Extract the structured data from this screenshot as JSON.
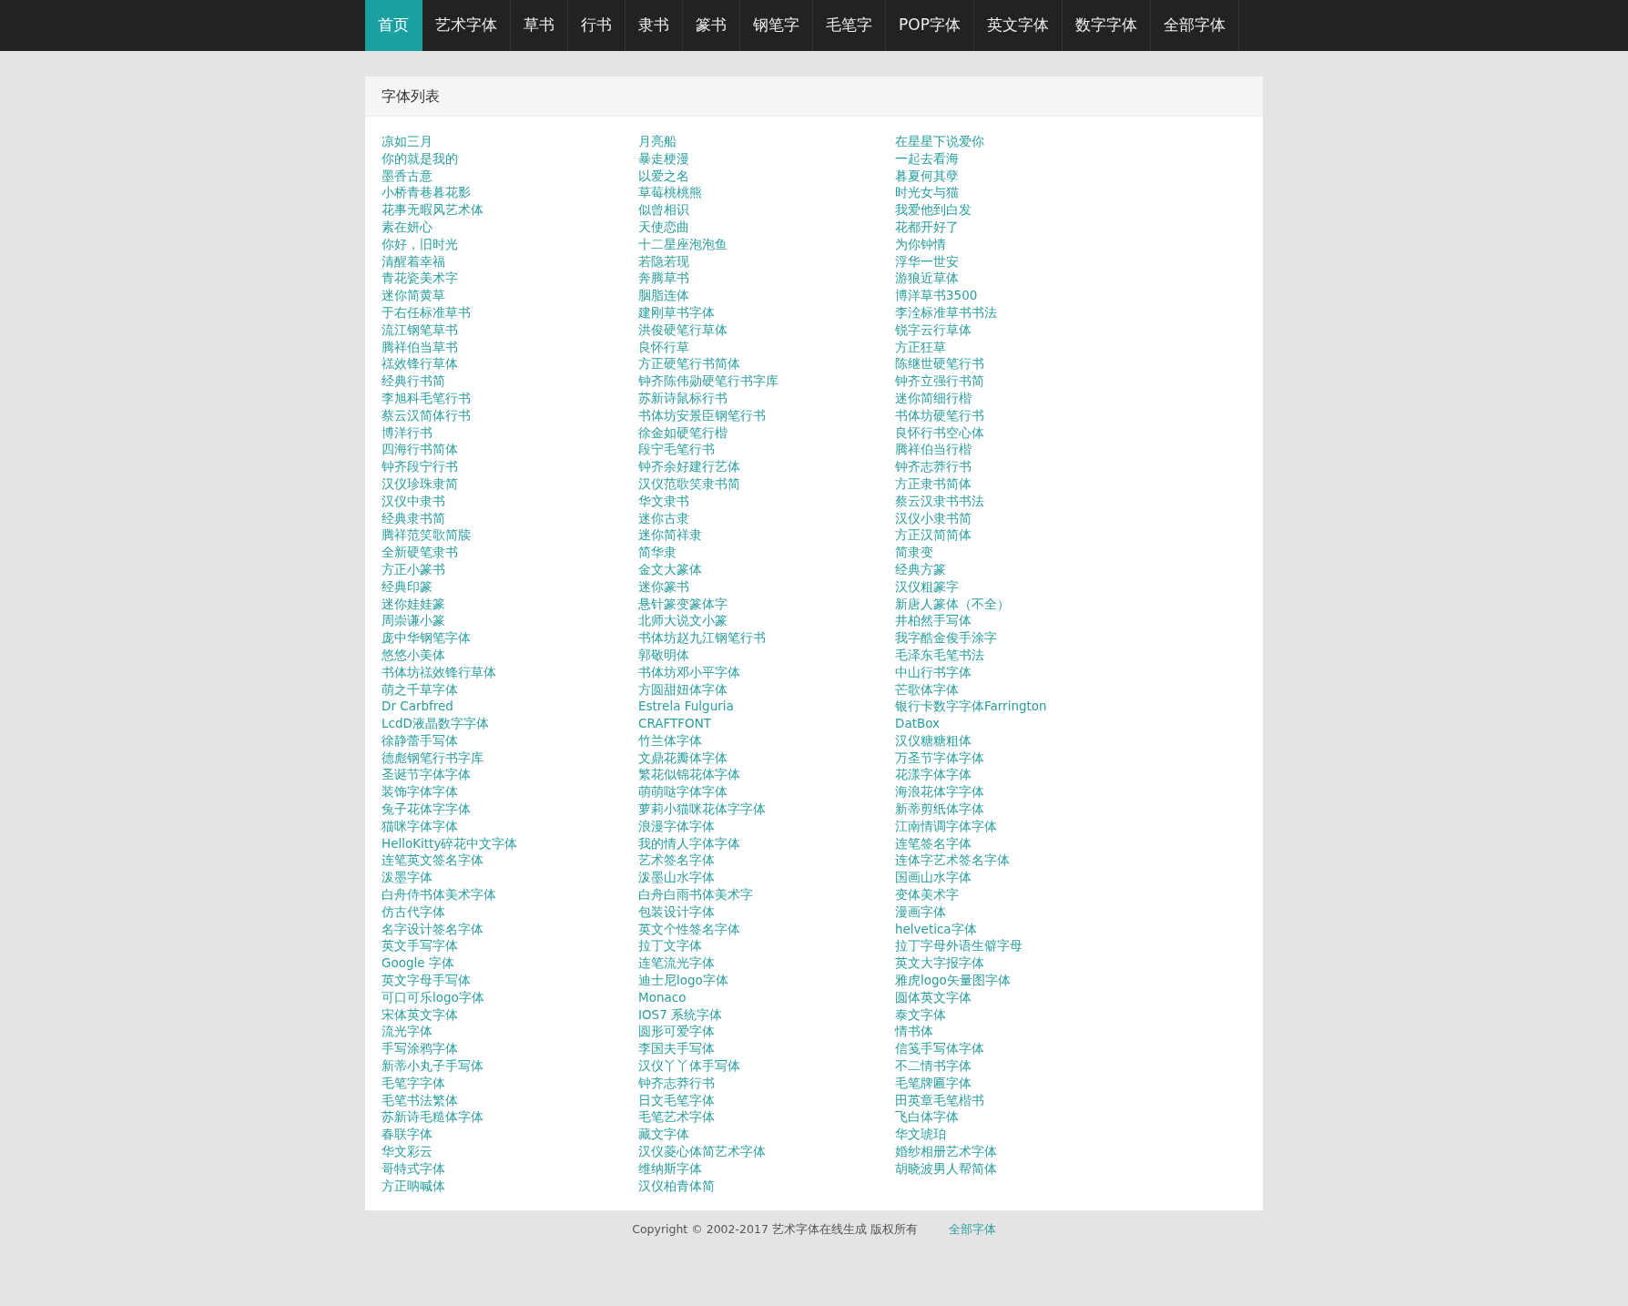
{
  "navbar": {
    "items": [
      {
        "label": "首页",
        "selected": true
      },
      {
        "label": "艺术字体",
        "selected": false
      },
      {
        "label": "草书",
        "selected": false
      },
      {
        "label": "行书",
        "selected": false
      },
      {
        "label": "隶书",
        "selected": false
      },
      {
        "label": "篆书",
        "selected": false
      },
      {
        "label": "钢笔字",
        "selected": false
      },
      {
        "label": "毛笔字",
        "selected": false
      },
      {
        "label": "POP字体",
        "selected": false
      },
      {
        "label": "英文字体",
        "selected": false
      },
      {
        "label": "数字字体",
        "selected": false
      },
      {
        "label": "全部字体",
        "selected": false
      }
    ]
  },
  "panel": {
    "title": "字体列表",
    "columns": [
      {
        "items": [
          "凉如三月",
          "你的就是我的",
          "墨香古意",
          "小桥青巷暮花影",
          "花事无暇风艺术体",
          "素在妍心",
          "你好，旧时光",
          "清醒着幸福",
          "青花瓷美术字",
          "迷你简黄草",
          "于右任标准草书",
          "流江钢笔草书",
          "腾祥伯当草书",
          "禚效锋行草体",
          "经典行书简",
          "李旭科毛笔行书",
          "蔡云汉简体行书",
          "博洋行书",
          "四海行书简体",
          "钟齐段宁行书",
          "汉仪珍珠隶简",
          "汉仪中隶书",
          "经典隶书简",
          "腾祥范笑歌简牍",
          "全新硬笔隶书",
          "方正小篆书",
          "经典印篆",
          "迷你娃娃篆",
          "周崇谦小篆",
          "庞中华钢笔字体",
          "悠悠小美体",
          "书体坊禚效锋行草体",
          "萌之千草字体",
          "Dr Carbfred",
          "LcdD液晶数字字体",
          "徐静蕾手写体",
          "德彪钢笔行书字库",
          "圣诞节字体字体",
          "装饰字体字体",
          "兔子花体字字体",
          "猫咪字体字体",
          "HelloKitty碎花中文字体",
          "连笔英文签名字体",
          "泼墨字体",
          "白舟侍书体美术字体",
          "仿古代字体",
          "名字设计签名字体",
          "英文手写字体",
          "Google 字体",
          "英文字母手写体",
          "可口可乐logo字体",
          "宋体英文字体",
          "流光字体",
          "手写涂鸦字体",
          "新蒂小丸子手写体",
          "毛笔字字体",
          "毛笔书法繁体",
          "苏新诗毛糙体字体",
          "春联字体",
          "华文彩云",
          "哥特式字体",
          "方正呐喊体"
        ]
      },
      {
        "items": [
          "月亮船",
          "暴走梗漫",
          "以爱之名",
          "草莓桃桃熊",
          "似曾相识",
          "天使恋曲",
          "十二星座泡泡鱼",
          "若隐若现",
          "奔腾草书",
          "胭脂连体",
          "建刚草书字体",
          "洪俊硬笔行草体",
          "良怀行草",
          "方正硬笔行书简体",
          "钟齐陈伟勋硬笔行书字库",
          "苏新诗鼠标行书",
          "书体坊安景臣钢笔行书",
          "徐金如硬笔行楷",
          "段宁毛笔行书",
          "钟齐余好建行艺体",
          "汉仪范歌笑隶书简",
          "华文隶书",
          "迷你古隶",
          "迷你简祥隶",
          "简华隶",
          "金文大篆体",
          "迷你篆书",
          "悬针篆变篆体字",
          "北师大说文小篆",
          "书体坊赵九江钢笔行书",
          "郭敬明体",
          "书体坊邓小平字体",
          "方圆甜妞体字体",
          "Estrela Fulguria",
          "CRAFTFONT",
          "竹兰体字体",
          "文鼎花瓣体字体",
          "繁花似锦花体字体",
          "萌萌哒字体字体",
          "萝莉小猫咪花体字字体",
          "浪漫字体字体",
          "我的情人字体字体",
          "艺术签名字体",
          "泼墨山水字体",
          "白舟白雨书体美术字",
          "包装设计字体",
          "英文个性签名字体",
          "拉丁文字体",
          "连笔流光字体",
          "迪士尼logo字体",
          "Monaco",
          "IOS7 系统字体",
          "圆形可爱字体",
          "李国夫手写体",
          "汉仪丫丫体手写体",
          "钟齐志莽行书",
          "日文毛笔字体",
          "毛笔艺术字体",
          "藏文字体",
          "汉仪菱心体简艺术字体",
          "维纳斯字体",
          "汉仪柏青体简"
        ]
      },
      {
        "items": [
          "在星星下说爱你",
          "一起去看海",
          "暮夏何其孽",
          "时光女与猫",
          "我爱他到白发",
          "花都开好了",
          "为你钟情",
          "浮华一世安",
          "游狼近草体",
          "博洋草书3500",
          "李洤标准草书书法",
          "锐字云行草体",
          "方正狂草",
          "陈继世硬笔行书",
          "钟齐立强行书简",
          "迷你简细行楷",
          "书体坊硬笔行书",
          "良怀行书空心体",
          "腾祥伯当行楷",
          "钟齐志莽行书",
          "方正隶书简体",
          "蔡云汉隶书书法",
          "汉仪小隶书简",
          "方正汉简简体",
          "简隶变",
          "经典方篆",
          "汉仪粗篆字",
          "新唐人篆体（不全）",
          "井柏然手写体",
          "我字酷金俊手涂字",
          "毛泽东毛笔书法",
          "中山行书字体",
          "芒歌体字体",
          "银行卡数字字体Farrington",
          "DatBox",
          "汉仪糖糖粗体",
          "万圣节字体字体",
          "花漾字体字体",
          "海浪花体字字体",
          "新蒂剪纸体字体",
          "江南情调字体字体",
          "连笔签名字体",
          "连体字艺术签名字体",
          "国画山水字体",
          "变体美术字",
          "漫画字体",
          "helvetica字体",
          "拉丁字母外语生僻字母",
          "英文大字报字体",
          "雅虎logo矢量图字体",
          "圆体英文字体",
          "泰文字体",
          "情书体",
          "信笺手写体字体",
          "不二情书字体",
          "毛笔牌匾字体",
          "田英章毛笔楷书",
          "飞白体字体",
          "华文琥珀",
          "婚纱相册艺术字体",
          "胡晓波男人帮简体"
        ]
      }
    ]
  },
  "footer": {
    "copyright": "Copyright © 2002-2017 艺术字体在线生成 版权所有",
    "link": "全部字体"
  }
}
